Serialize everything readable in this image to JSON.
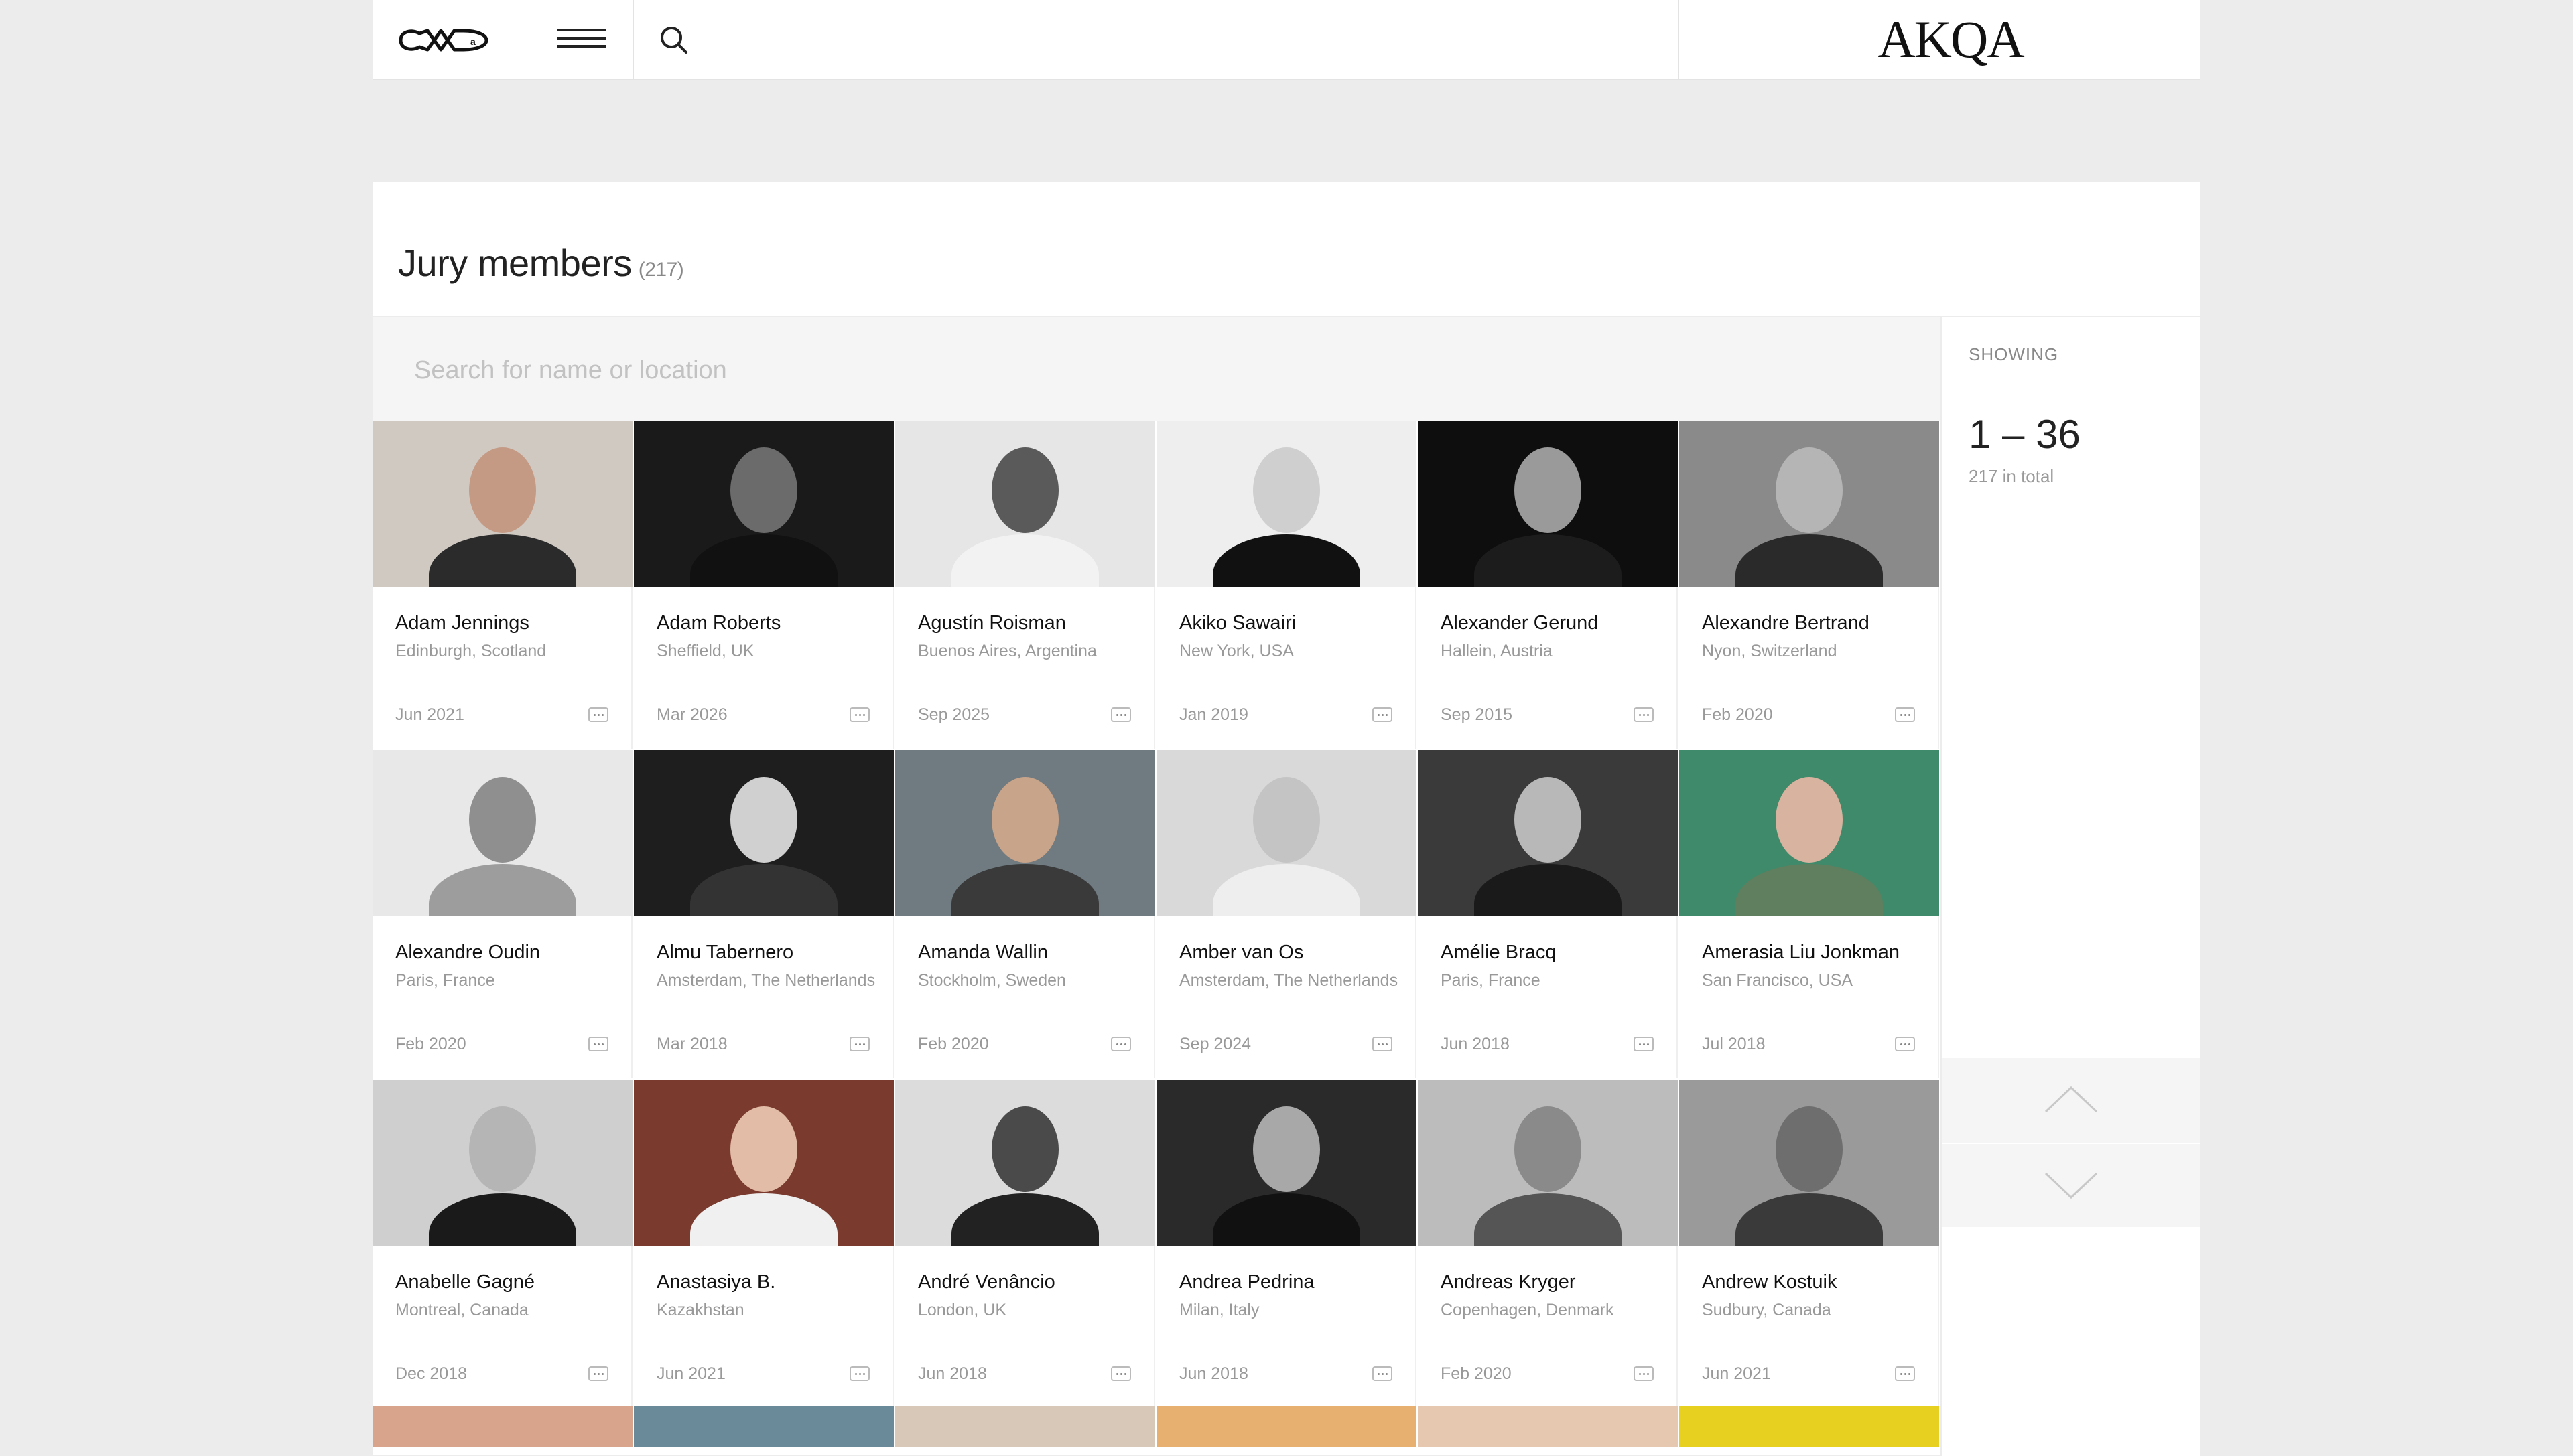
{
  "header": {
    "logo_left": "FWA",
    "logo_right": "AKQA"
  },
  "panel": {
    "title": "Jury members",
    "count": "(217)"
  },
  "search": {
    "placeholder": "Search for name or location"
  },
  "sidebar": {
    "label": "SHOWING",
    "range": "1 – 36",
    "total": "217 in total"
  },
  "members": [
    {
      "name": "Adam Jennings",
      "location": "Edinburgh, Scotland",
      "date": "Jun 2021",
      "bg": "#cfc9c2",
      "skin": "#c49a85",
      "shirt": "#2b2b2b"
    },
    {
      "name": "Adam Roberts",
      "location": "Sheffield, UK",
      "date": "Mar 2026",
      "bg": "#1a1a1a",
      "skin": "#6b6b6b",
      "shirt": "#111111"
    },
    {
      "name": "Agustín Roisman",
      "location": "Buenos Aires, Argentina",
      "date": "Sep 2025",
      "bg": "#e6e6e6",
      "skin": "#5a5a5a",
      "shirt": "#f2f2f2"
    },
    {
      "name": "Akiko Sawairi",
      "location": "New York, USA",
      "date": "Jan 2019",
      "bg": "#eeeeee",
      "skin": "#cfcfcf",
      "shirt": "#111111"
    },
    {
      "name": "Alexander Gerund",
      "location": "Hallein, Austria",
      "date": "Sep 2015",
      "bg": "#0e0e0e",
      "skin": "#9a9a9a",
      "shirt": "#1c1c1c"
    },
    {
      "name": "Alexandre Bertrand",
      "location": "Nyon, Switzerland",
      "date": "Feb 2020",
      "bg": "#8a8a8a",
      "skin": "#b5b5b5",
      "shirt": "#2a2a2a"
    },
    {
      "name": "Alexandre Oudin",
      "location": "Paris, France",
      "date": "Feb 2020",
      "bg": "#e8e8e8",
      "skin": "#8f8f8f",
      "shirt": "#9d9d9d"
    },
    {
      "name": "Almu Tabernero",
      "location": "Amsterdam, The Netherlands",
      "date": "Mar 2018",
      "bg": "#1e1e1e",
      "skin": "#d0d0d0",
      "shirt": "#333333"
    },
    {
      "name": "Amanda Wallin",
      "location": "Stockholm, Sweden",
      "date": "Feb 2020",
      "bg": "#6f7b80",
      "skin": "#c8a48a",
      "shirt": "#3a3a3a"
    },
    {
      "name": "Amber van Os",
      "location": "Amsterdam, The Netherlands",
      "date": "Sep 2024",
      "bg": "#d9d9d9",
      "skin": "#c4c4c4",
      "shirt": "#eeeeee"
    },
    {
      "name": "Amélie Bracq",
      "location": "Paris, France",
      "date": "Jun 2018",
      "bg": "#3a3a3a",
      "skin": "#b8b8b8",
      "shirt": "#1a1a1a"
    },
    {
      "name": "Amerasia Liu Jonkman",
      "location": "San Francisco, USA",
      "date": "Jul 2018",
      "bg": "#3f8a6a",
      "skin": "#d8b4a0",
      "shirt": "#5f7f5f"
    },
    {
      "name": "Anabelle Gagné",
      "location": "Montreal, Canada",
      "date": "Dec 2018",
      "bg": "#cfcfcf",
      "skin": "#b5b5b5",
      "shirt": "#1a1a1a"
    },
    {
      "name": "Anastasiya B.",
      "location": "Kazakhstan",
      "date": "Jun 2021",
      "bg": "#7a3a2e",
      "skin": "#e2bca6",
      "shirt": "#f0f0f0"
    },
    {
      "name": "André Venâncio",
      "location": "London, UK",
      "date": "Jun 2018",
      "bg": "#dcdcdc",
      "skin": "#4a4a4a",
      "shirt": "#222222"
    },
    {
      "name": "Andrea Pedrina",
      "location": "Milan, Italy",
      "date": "Jun 2018",
      "bg": "#2a2a2a",
      "skin": "#a8a8a8",
      "shirt": "#111111"
    },
    {
      "name": "Andreas Kryger",
      "location": "Copenhagen, Denmark",
      "date": "Feb 2020",
      "bg": "#bcbcbc",
      "skin": "#8a8a8a",
      "shirt": "#555555"
    },
    {
      "name": "Andrew Kostuik",
      "location": "Sudbury, Canada",
      "date": "Jun 2021",
      "bg": "#9a9a9a",
      "skin": "#6e6e6e",
      "shirt": "#3a3a3a"
    }
  ],
  "partial_row": [
    {
      "bg": "#d8a48c"
    },
    {
      "bg": "#6a8a9a"
    },
    {
      "bg": "#d8c8b8"
    },
    {
      "bg": "#e8b070"
    },
    {
      "bg": "#e6c8b0"
    },
    {
      "bg": "#e8d020"
    }
  ]
}
